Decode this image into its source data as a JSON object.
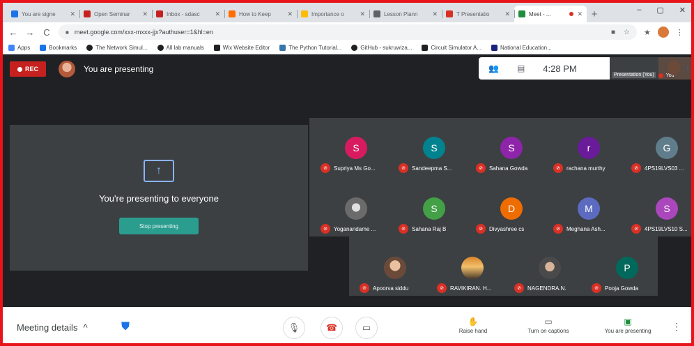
{
  "browser": {
    "tabs": [
      {
        "title": "You are signe",
        "color": "#1a73e8"
      },
      {
        "title": "Open Seminar",
        "color": "#c5221f"
      },
      {
        "title": "Inbox - sdasc",
        "color": "#c5221f"
      },
      {
        "title": "How to Keep",
        "color": "#ff6d00"
      },
      {
        "title": "Importance o",
        "color": "#fbbc04"
      },
      {
        "title": "Lesson Plann",
        "color": "#5f6368"
      },
      {
        "title": "T Presentatio",
        "color": "#d93025"
      },
      {
        "title": "Meet - ...",
        "color": "#1e8e3e"
      }
    ],
    "new_tab": "+",
    "window_controls": {
      "minimize": "–",
      "maximize": "▢",
      "close": "✕"
    },
    "nav": {
      "back": "←",
      "forward": "→",
      "reload": "C"
    },
    "url": "meet.google.com/xxx-mxxx-jjx?authuser=1&hl=en",
    "bookmarks": [
      {
        "label": "Apps",
        "color": "#4285f4"
      },
      {
        "label": "Bookmarks",
        "color": "#1a73e8"
      },
      {
        "label": "The Network Simul...",
        "color": "#202124"
      },
      {
        "label": "All lab manuals",
        "color": "#202124"
      },
      {
        "label": "Wix Website Editor",
        "color": "#202124"
      },
      {
        "label": "The Python Tutorial...",
        "color": "#3776ab"
      },
      {
        "label": "GitHub - sukruwiza...",
        "color": "#202124"
      },
      {
        "label": "Circuit Simulator A...",
        "color": "#202124"
      },
      {
        "label": "National Education...",
        "color": "#1a237e"
      }
    ]
  },
  "meet": {
    "rec_label": "REC",
    "presenting_title": "You are presenting",
    "time": "4:28 PM",
    "self_tile": {
      "label": "Presentation (You)",
      "name": "You"
    },
    "present_tile": {
      "message": "You're presenting to everyone",
      "stop_button": "Stop presenting"
    },
    "participants": [
      {
        "initial": "S",
        "name": "Supriya Ms Go...",
        "color": "#d81b60"
      },
      {
        "initial": "S",
        "name": "Sandeepma S...",
        "color": "#00838f"
      },
      {
        "initial": "S",
        "name": "Sahana Gowda",
        "color": "#8e24aa"
      },
      {
        "initial": "r",
        "name": "rachana murthy",
        "color": "#6a1b9a"
      },
      {
        "initial": "G",
        "name": "4PS19LVS03 ...",
        "color": "#607d8b"
      },
      {
        "initial": "",
        "name": "Yoganandame ...",
        "color": "photo"
      },
      {
        "initial": "S",
        "name": "Sahana Raj B",
        "color": "#43a047"
      },
      {
        "initial": "D",
        "name": "Divyashree cs",
        "color": "#ef6c00"
      },
      {
        "initial": "M",
        "name": "Meghana Ash...",
        "color": "#5c6bc0"
      },
      {
        "initial": "S",
        "name": "4PS19LVS10 S...",
        "color": "#ab47bc"
      },
      {
        "initial": "",
        "name": "Apoorva siddu",
        "color": "photo"
      },
      {
        "initial": "",
        "name": "RAVIKIRAN. H...",
        "color": "photo"
      },
      {
        "initial": "",
        "name": "NAGENDRA.N.",
        "color": "photo"
      },
      {
        "initial": "P",
        "name": "Pooja Gowda",
        "color": "#00695c"
      }
    ]
  },
  "bottombar": {
    "meeting_details": "Meeting details",
    "raise_hand": "Raise hand",
    "captions": "Turn on captions",
    "presenting": "You are presenting"
  }
}
